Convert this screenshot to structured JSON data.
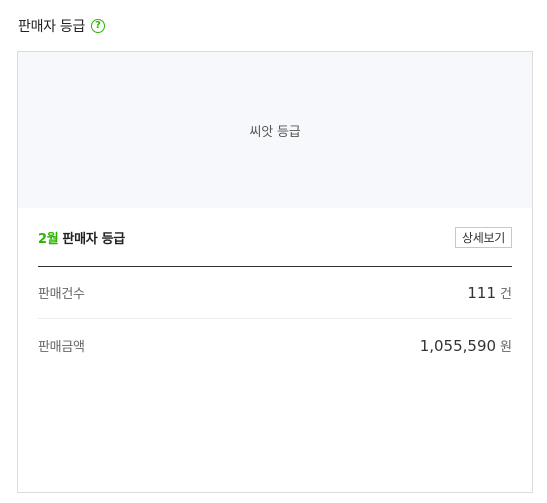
{
  "header": {
    "title": "판매자 등급",
    "help_icon": "question-circle-icon",
    "help_symbol": "?"
  },
  "grade": {
    "name": "씨앗 등급"
  },
  "summary": {
    "month": "2월",
    "title": "판매자 등급",
    "detail_button": "상세보기"
  },
  "stats": [
    {
      "label": "판매건수",
      "value": "111",
      "unit": "건"
    },
    {
      "label": "판매금액",
      "value": "1,055,590",
      "unit": "원"
    }
  ],
  "colors": {
    "accent": "#2db400",
    "banner_bg": "#f7f8fc"
  }
}
